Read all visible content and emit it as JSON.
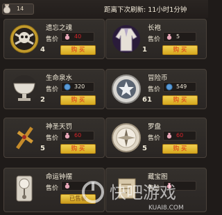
{
  "header": {
    "coins": "14",
    "refresh_text": "距离下次刷新: 11小时1分钟"
  },
  "items": [
    {
      "name": "遗忘之魂",
      "price_label": "售价",
      "price": "40",
      "quantity": "4",
      "button": "购 买",
      "currency": "pink-bag"
    },
    {
      "name": "长袍",
      "price_label": "售价",
      "price": "5",
      "quantity": "1",
      "button": "购 买",
      "currency": "pink-bag"
    },
    {
      "name": "生命泉水",
      "price_label": "售价",
      "price": "320",
      "quantity": "2",
      "button": "购 买",
      "currency": "blue-coin"
    },
    {
      "name": "冒险币",
      "price_label": "售价",
      "price": "549",
      "quantity": "61",
      "button": "购 买",
      "currency": "blue-coin"
    },
    {
      "name": "神圣天罚",
      "price_label": "售价",
      "price": "60",
      "quantity": "5",
      "button": "购 买",
      "currency": "pink-bag"
    },
    {
      "name": "罗盘",
      "price_label": "售价",
      "price": "60",
      "quantity": "5",
      "button": "购 买",
      "currency": "pink-bag"
    },
    {
      "name": "命运钟摆",
      "price_label": "售价",
      "price": "",
      "quantity": "",
      "button": "已售罄",
      "currency": "pink-bag"
    },
    {
      "name": "藏宝图",
      "price_label": "售价",
      "price": "",
      "quantity": "",
      "button": "",
      "currency": "pink-bag"
    }
  ],
  "watermark": {
    "text": "快吧游戏",
    "url": "KUAI8.COM"
  },
  "colors": {
    "button": "#e2b62f",
    "button_text": "#d82b13",
    "card_bg": "#2f2b28"
  }
}
